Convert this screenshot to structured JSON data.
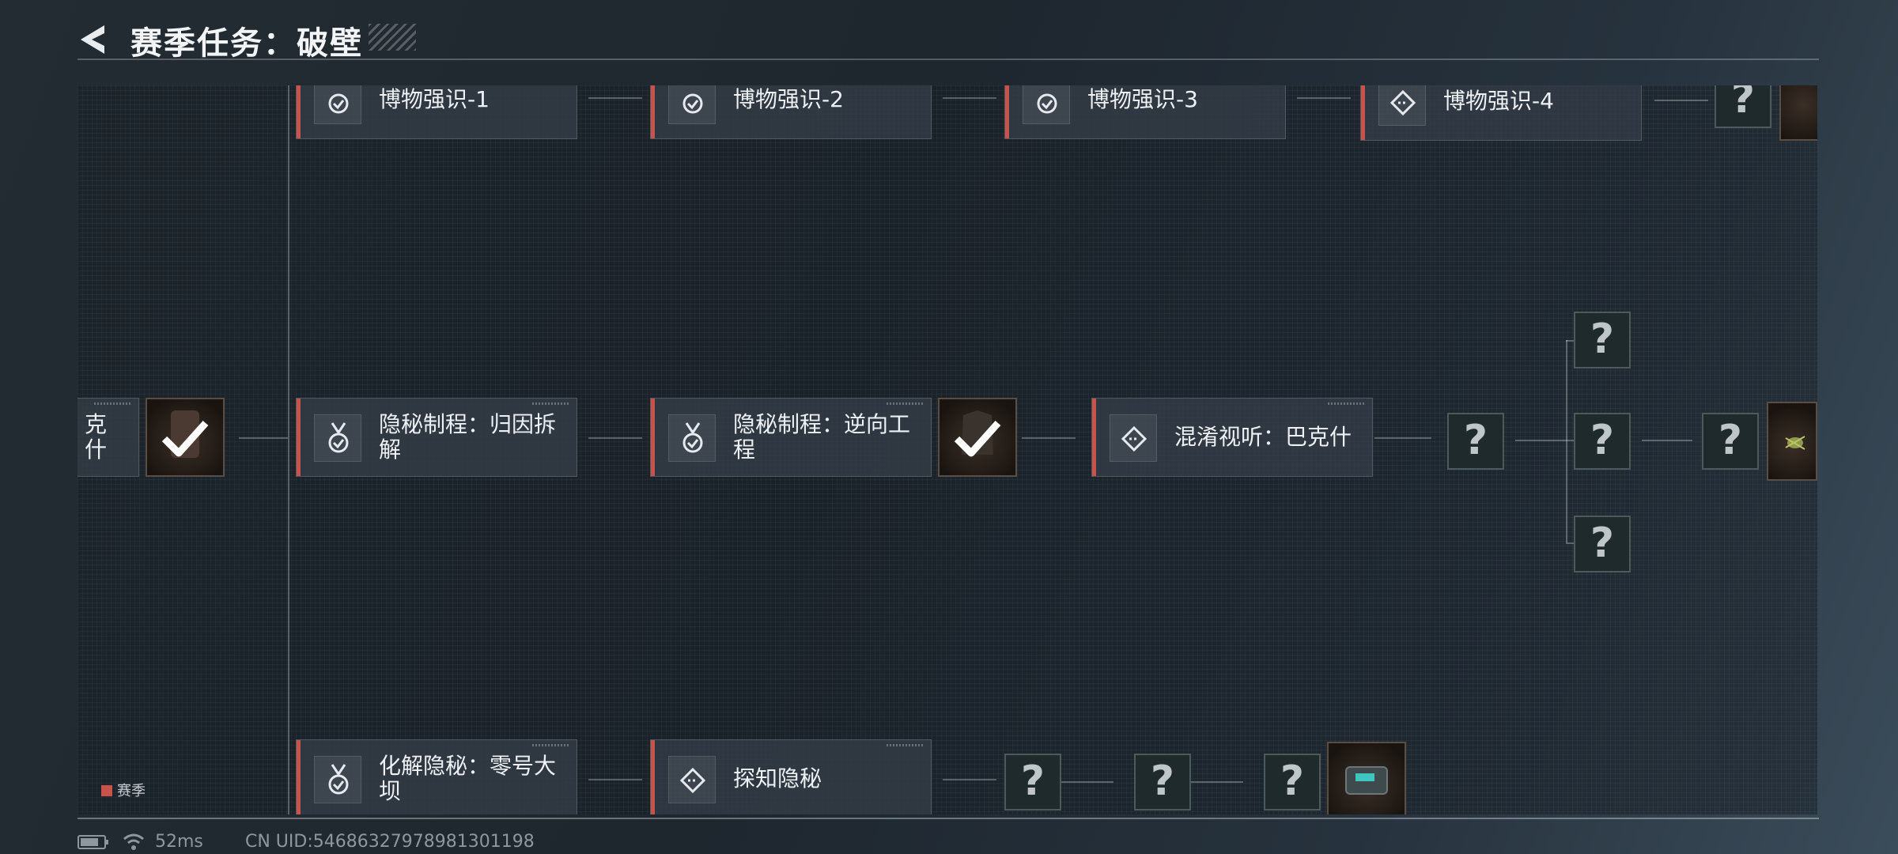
{
  "header": {
    "title": "赛季任务：破壁"
  },
  "tasks": {
    "row1": [
      "博物强识-1",
      "博物强识-2",
      "博物强识-3",
      "博物强识-4"
    ],
    "row2": {
      "partial": "克什",
      "t1": "隐秘制程：归因拆解",
      "t2": "隐秘制程：逆向工程",
      "t3": "混淆视听：巴克什"
    },
    "row3": {
      "t1": "化解隐秘：零号大坝",
      "t2": "探知隐秘"
    }
  },
  "unknown_symbol": "?",
  "legend": {
    "label": "赛季",
    "color": "#c9524a"
  },
  "status": {
    "ping": "52ms",
    "uid": "CN UID:546863279789813011​98"
  },
  "colors": {
    "accent": "#c9524a"
  }
}
